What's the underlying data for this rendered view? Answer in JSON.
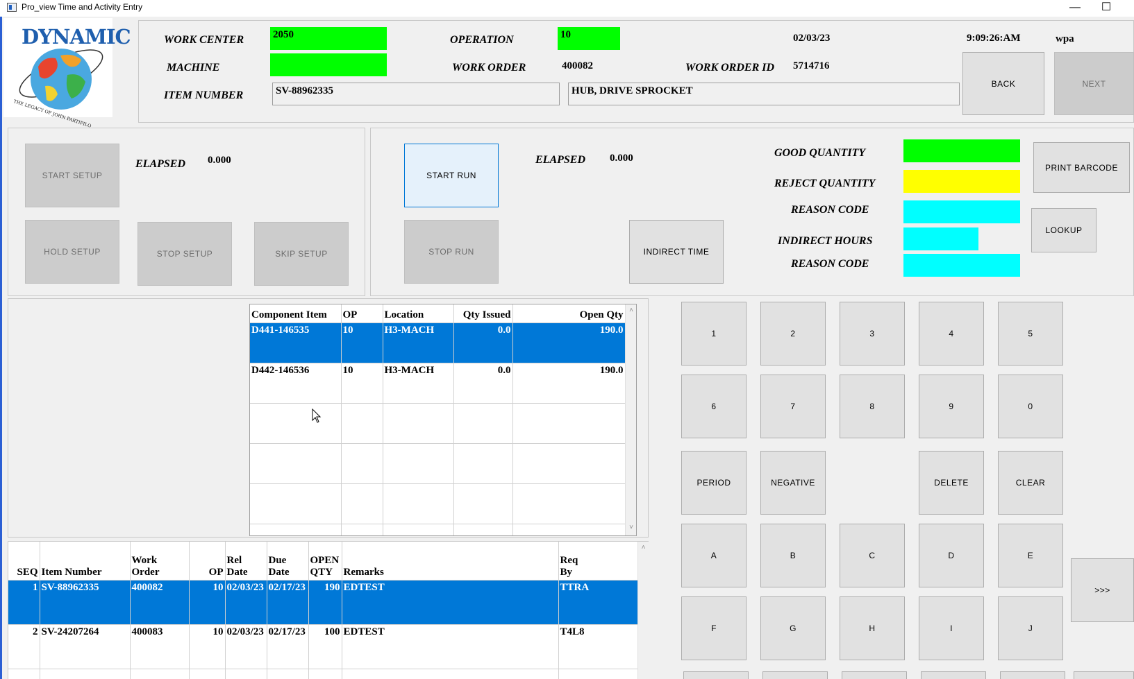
{
  "window": {
    "title": "Pro_view Time and Activity Entry",
    "minimize_glyph": "—",
    "maximize_glyph": "☐"
  },
  "logo": {
    "text": "DYNAMIC",
    "tagline": "THE LEGACY OF JOHN PARTIPILO"
  },
  "header": {
    "work_center_label": "WORK CENTER",
    "work_center_value": "2050",
    "operation_label": "OPERATION",
    "operation_value": "10",
    "date": "02/03/23",
    "time": "9:09:26:AM",
    "user": "wpa",
    "machine_label": "MACHINE",
    "machine_value": "",
    "work_order_label": "WORK ORDER",
    "work_order_value": "400082",
    "work_order_id_label": "WORK ORDER ID",
    "work_order_id_value": "5714716",
    "item_number_label": "ITEM NUMBER",
    "item_number_value": "SV-88962335",
    "item_description": "HUB, DRIVE SPROCKET",
    "back_label": "BACK",
    "next_label": "NEXT"
  },
  "setup": {
    "start_label": "START SETUP",
    "elapsed_label": "ELAPSED",
    "elapsed_value": "0.000",
    "hold_label": "HOLD SETUP",
    "stop_label": "STOP SETUP",
    "skip_label": "SKIP SETUP"
  },
  "run": {
    "start_label": "START RUN",
    "elapsed_label": "ELAPSED",
    "elapsed_value": "0.000",
    "stop_label": "STOP RUN",
    "indirect_time_label": "INDIRECT TIME",
    "good_qty_label": "GOOD QUANTITY",
    "reject_qty_label": "REJECT QUANTITY",
    "reason_code_label": "REASON CODE",
    "indirect_hours_label": "INDIRECT HOURS",
    "reason_code2_label": "REASON CODE",
    "print_barcode_label": "PRINT BARCODE",
    "lookup_label": "LOOKUP"
  },
  "components": {
    "headers": [
      "Component Item",
      "OP",
      "Location",
      "Qty Issued",
      "Open Qty"
    ],
    "rows": [
      [
        "D441-146535",
        "10",
        "H3-MACH",
        "0.0",
        "190.0"
      ],
      [
        "D442-146536",
        "10",
        "H3-MACH",
        "0.0",
        "190.0"
      ],
      [
        "",
        "",
        "",
        "",
        ""
      ],
      [
        "",
        "",
        "",
        "",
        ""
      ],
      [
        "",
        "",
        "",
        "",
        ""
      ],
      [
        "",
        "",
        "",
        "",
        ""
      ]
    ],
    "selected_row": 0
  },
  "orders": {
    "headers": [
      [
        "",
        "SEQ"
      ],
      [
        "",
        "Item Number"
      ],
      [
        "",
        "Work Order"
      ],
      [
        "",
        "OP"
      ],
      [
        "Rel",
        "Date"
      ],
      [
        "Due",
        "Date"
      ],
      [
        "OPEN",
        "QTY"
      ],
      [
        "",
        "Remarks"
      ],
      [
        "Req",
        "By"
      ]
    ],
    "rows": [
      [
        "1",
        "SV-88962335",
        "400082",
        "10",
        "02/03/23",
        "02/17/23",
        "190",
        "EDTEST",
        "TTRA"
      ],
      [
        "2",
        "SV-24207264",
        "400083",
        "10",
        "02/03/23",
        "02/17/23",
        "100",
        "EDTEST",
        "T4L8"
      ],
      [
        "",
        "",
        "",
        "",
        "",
        "",
        "",
        "",
        ""
      ]
    ],
    "selected_row": 0
  },
  "keypad": {
    "rows": [
      [
        "1",
        "2",
        "3",
        "4",
        "5"
      ],
      [
        "6",
        "7",
        "8",
        "9",
        "0"
      ],
      [
        "PERIOD",
        "NEGATIVE",
        "",
        "DELETE",
        "CLEAR"
      ],
      [
        "A",
        "B",
        "C",
        "D",
        "E"
      ],
      [
        "F",
        "G",
        "H",
        "I",
        "J"
      ]
    ],
    "more_label": ">>>"
  },
  "colors": {
    "green": "#00ff00",
    "yellow": "#ffff00",
    "cyan": "#00ffff",
    "selection": "#0078d7"
  }
}
